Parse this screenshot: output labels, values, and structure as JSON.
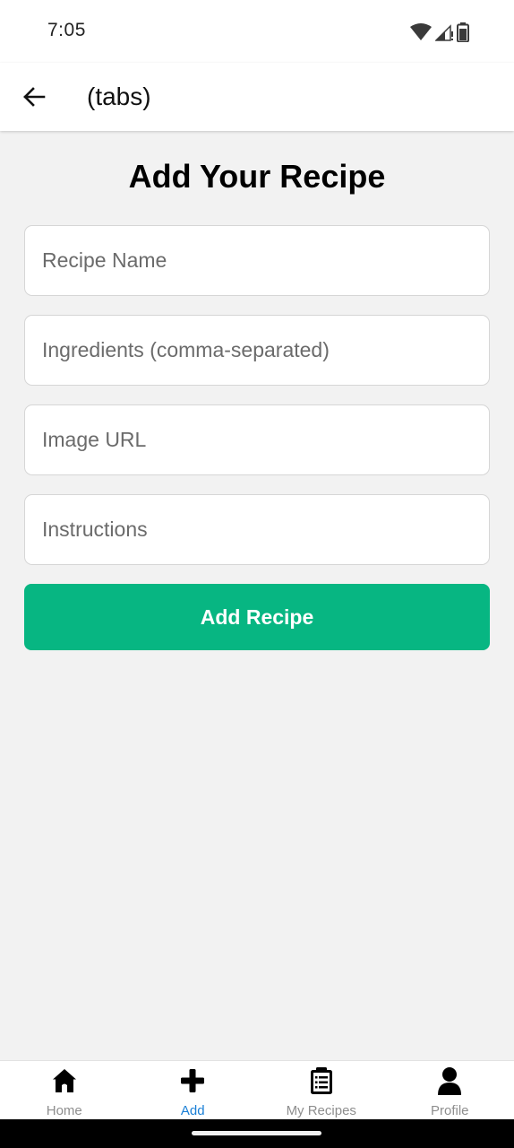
{
  "status_bar": {
    "time": "7:05",
    "icons": [
      "wifi-icon",
      "cell-signal-icon",
      "battery-icon"
    ]
  },
  "app_bar": {
    "back_icon": "arrow-left-icon",
    "title": "(tabs)"
  },
  "main": {
    "heading": "Add Your Recipe",
    "fields": {
      "recipe_name": {
        "placeholder": "Recipe Name",
        "value": ""
      },
      "ingredients": {
        "placeholder": "Ingredients (comma-separated)",
        "value": ""
      },
      "image_url": {
        "placeholder": "Image URL",
        "value": ""
      },
      "instructions": {
        "placeholder": "Instructions",
        "value": ""
      }
    },
    "submit_label": "Add Recipe"
  },
  "tabs": [
    {
      "label": "Home",
      "icon": "home-icon",
      "active": false
    },
    {
      "label": "Add",
      "icon": "plus-icon",
      "active": true
    },
    {
      "label": "My Recipes",
      "icon": "clipboard-icon",
      "active": false
    },
    {
      "label": "Profile",
      "icon": "user-icon",
      "active": false
    }
  ],
  "colors": {
    "accent": "#07b682",
    "active_tab": "#1a7fd6",
    "inactive_tab": "#8e8e8e",
    "background": "#f2f2f2"
  }
}
